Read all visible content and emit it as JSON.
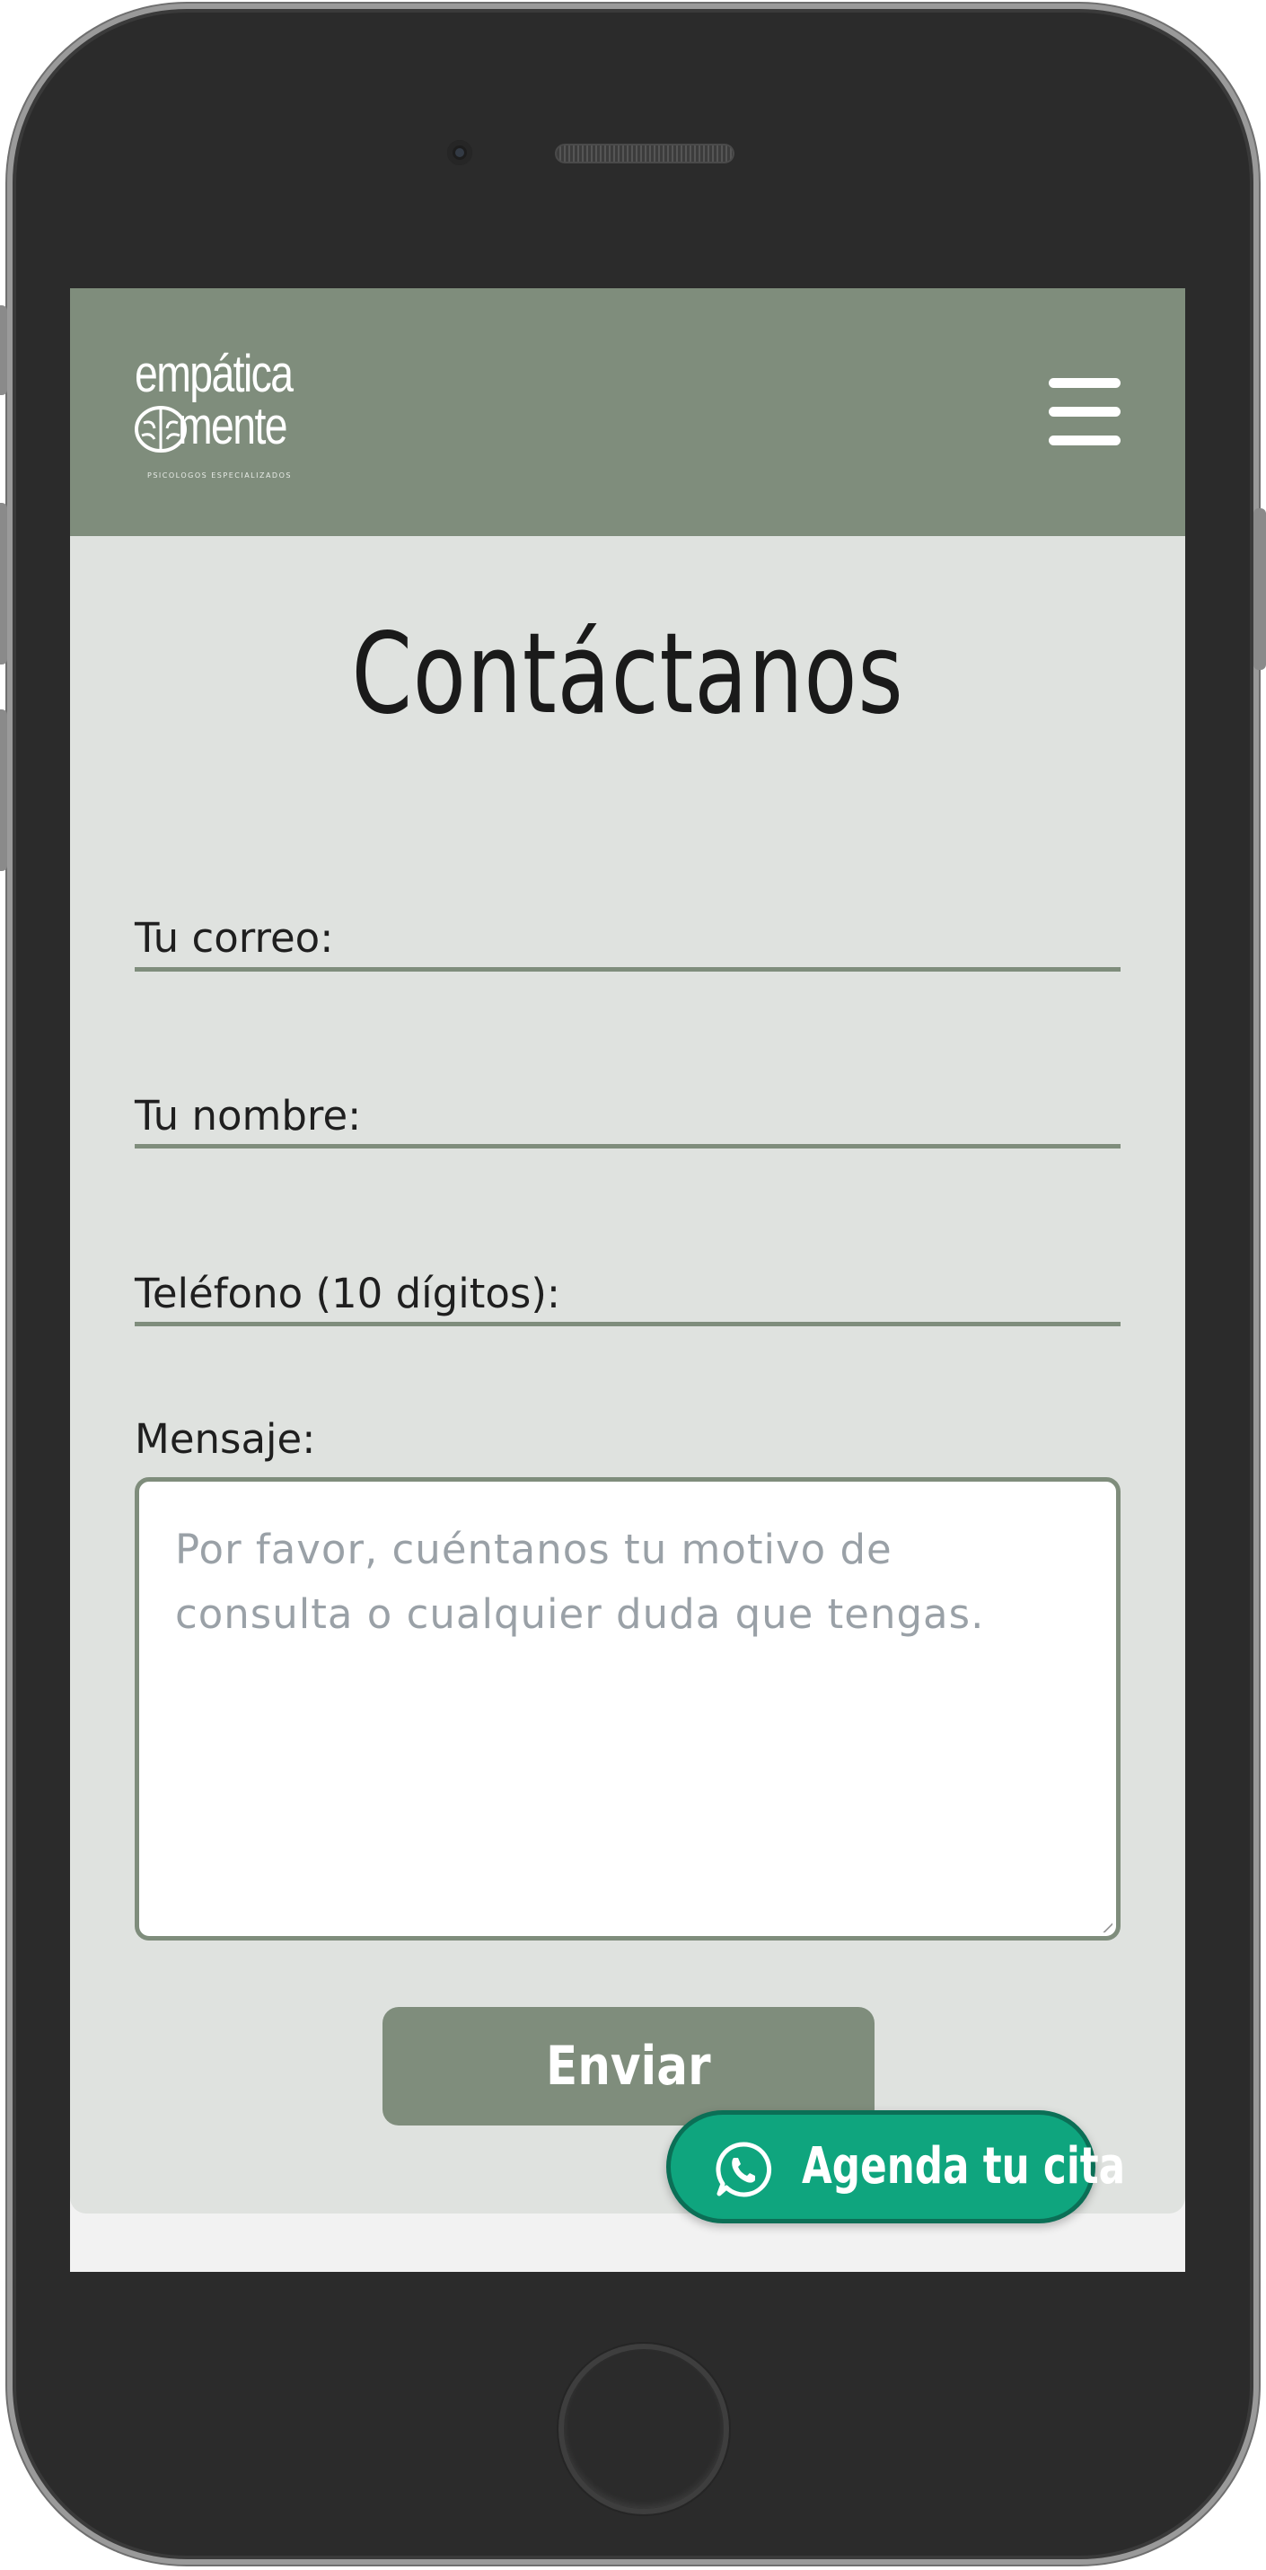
{
  "brand": {
    "logo_line1": "empática",
    "logo_line2": "mente",
    "tagline": "PSICOLOGOS ESPECIALIZADOS"
  },
  "header": {
    "menu_icon": "hamburger-menu-icon"
  },
  "page": {
    "title": "Contáctanos"
  },
  "form": {
    "email_label": "Tu correo:",
    "name_label": "Tu nombre:",
    "phone_label": "Teléfono (10 dígitos):",
    "message_label": "Mensaje:",
    "message_placeholder": "Por favor, cuéntanos tu motivo de consulta o cualquier duda que tengas.",
    "submit_label": "Enviar"
  },
  "whatsapp": {
    "label": "Agenda tu cita",
    "icon": "whatsapp-icon"
  },
  "colors": {
    "header_bg": "#7f8d7c",
    "content_bg": "#dfe2df",
    "whatsapp_green": "#0fa57e"
  }
}
